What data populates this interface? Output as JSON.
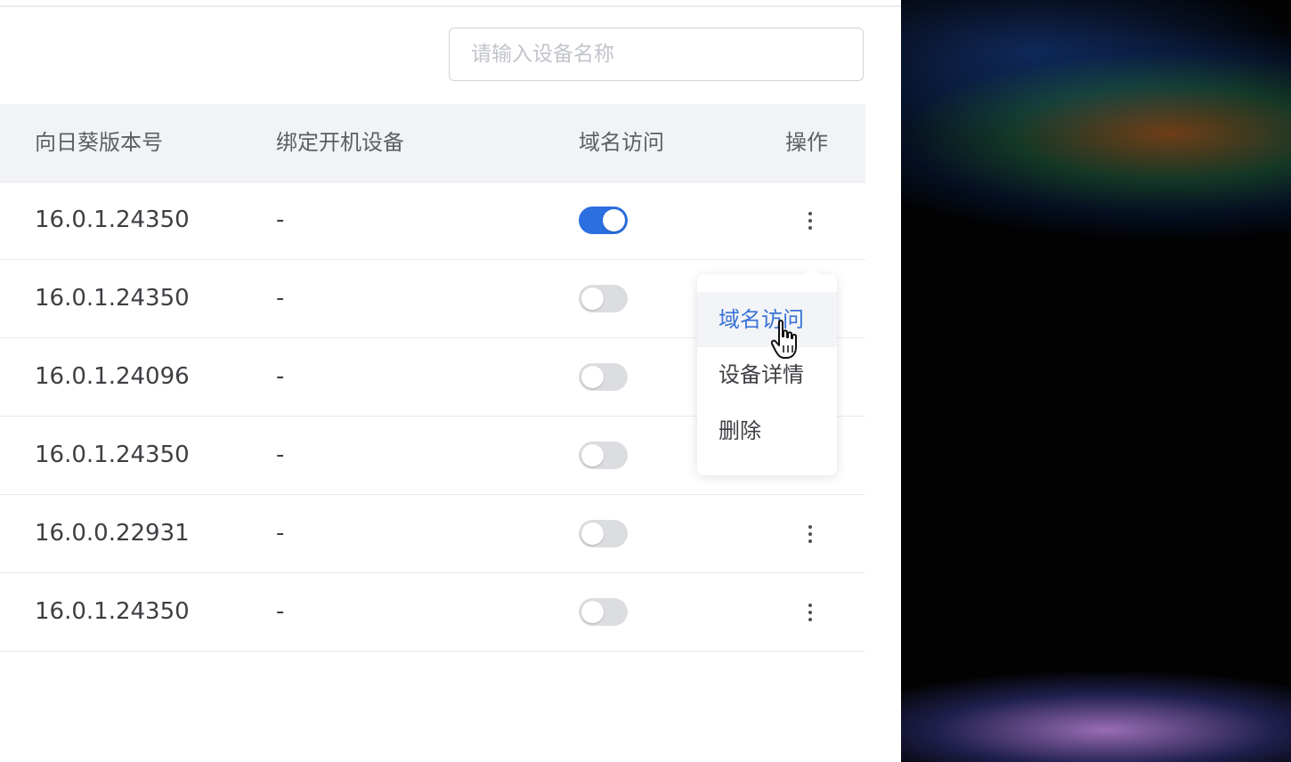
{
  "search": {
    "placeholder": "请输入设备名称"
  },
  "table": {
    "headers": {
      "version": "向日葵版本号",
      "bound_device": "绑定开机设备",
      "domain_access": "域名访问",
      "actions": "操作"
    },
    "rows": [
      {
        "version": "16.0.1.24350",
        "bound_device": "-",
        "domain_access": true
      },
      {
        "version": "16.0.1.24350",
        "bound_device": "-",
        "domain_access": false
      },
      {
        "version": "16.0.1.24096",
        "bound_device": "-",
        "domain_access": false
      },
      {
        "version": "16.0.1.24350",
        "bound_device": "-",
        "domain_access": false
      },
      {
        "version": "16.0.0.22931",
        "bound_device": "-",
        "domain_access": false
      },
      {
        "version": "16.0.1.24350",
        "bound_device": "-",
        "domain_access": false
      }
    ]
  },
  "context_menu": {
    "items": [
      {
        "label": "域名访问",
        "active": true
      },
      {
        "label": "设备详情",
        "active": false
      },
      {
        "label": "删除",
        "active": false
      }
    ]
  },
  "colors": {
    "accent": "#2c6fe0",
    "menu_active_text": "#3a73d8",
    "header_bg": "#f1f3f5"
  }
}
